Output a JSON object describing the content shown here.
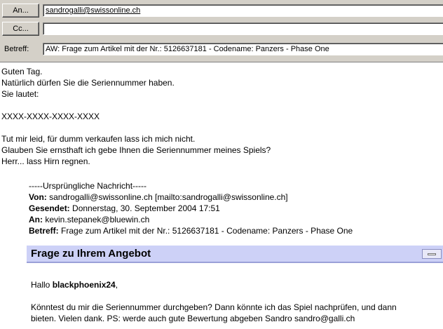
{
  "header": {
    "to_button": "An...",
    "to_value": "sandrogalli@swissonline.ch",
    "cc_button": "Cc...",
    "cc_value": "",
    "subject_label": "Betreff:",
    "subject_value": "AW: Frage zum Artikel mit der Nr.: 5126637181 - Codename: Panzers - Phase One"
  },
  "reply": {
    "lines": [
      "Guten Tag.",
      "Natürlich dürfen Sie die Seriennummer haben.",
      "Sie lautet:",
      "",
      "XXXX-XXXX-XXXX-XXXX",
      "",
      "Tut mir leid, für dumm verkaufen lass ich mich nicht.",
      "Glauben Sie ernsthaft ich gebe Ihnen die Seriennummer meines Spiels?",
      "Herr... lass Hirn regnen."
    ]
  },
  "original": {
    "separator": "-----Ursprüngliche Nachricht-----",
    "from_label": "Von:",
    "from_value": "sandrogalli@swissonline.ch [mailto:sandrogalli@swissonline.ch]",
    "sent_label": "Gesendet:",
    "sent_value": "Donnerstag, 30. September 2004 17:51",
    "to_label": "An:",
    "to_value": "kevin.stepanek@bluewin.ch",
    "subject_label": "Betreff:",
    "subject_value": "Frage zum Artikel mit der Nr.: 5126637181 - Codename: Panzers - Phase One"
  },
  "banner": {
    "title": "Frage zu Ihrem Angebot"
  },
  "message": {
    "greeting_prefix": "Hallo ",
    "greeting_name": "blackphoenix24",
    "greeting_suffix": ",",
    "text_line1": "Könntest du mir die Seriennummer durchgeben? Dann könnte ich das Spiel nachprüfen, und dann",
    "text_line2": "bieten. Vielen dank. PS: werde auch gute Bewertung abgeben Sandro sandro@galli.ch"
  }
}
